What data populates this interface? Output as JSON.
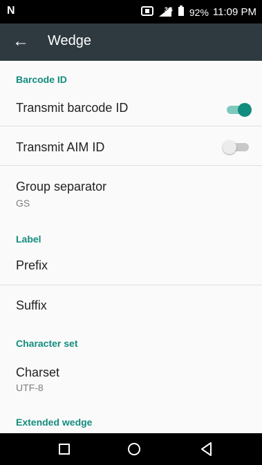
{
  "status": {
    "carrier_glyph": "N",
    "network": "3G",
    "battery": "92%",
    "time": "11:09 PM"
  },
  "app_bar": {
    "title": "Wedge"
  },
  "settings": {
    "barcode_id_section": "Barcode ID",
    "transmit_barcode_id": {
      "label": "Transmit barcode ID",
      "checked": true
    },
    "transmit_aim_id": {
      "label": "Transmit AIM ID",
      "checked": false
    },
    "group_separator": {
      "label": "Group separator",
      "value": "GS"
    },
    "label_section": "Label",
    "prefix": {
      "label": "Prefix"
    },
    "suffix": {
      "label": "Suffix"
    },
    "charset_section": "Character set",
    "charset": {
      "label": "Charset",
      "value": "UTF-8"
    },
    "extended_wedge_section": "Extended wedge"
  },
  "colors": {
    "accent": "#128c7e",
    "toggle_on_track": "#7fc8bf",
    "toggle_off_thumb": "#ececec",
    "toggle_off_track": "#c8c8c8"
  }
}
